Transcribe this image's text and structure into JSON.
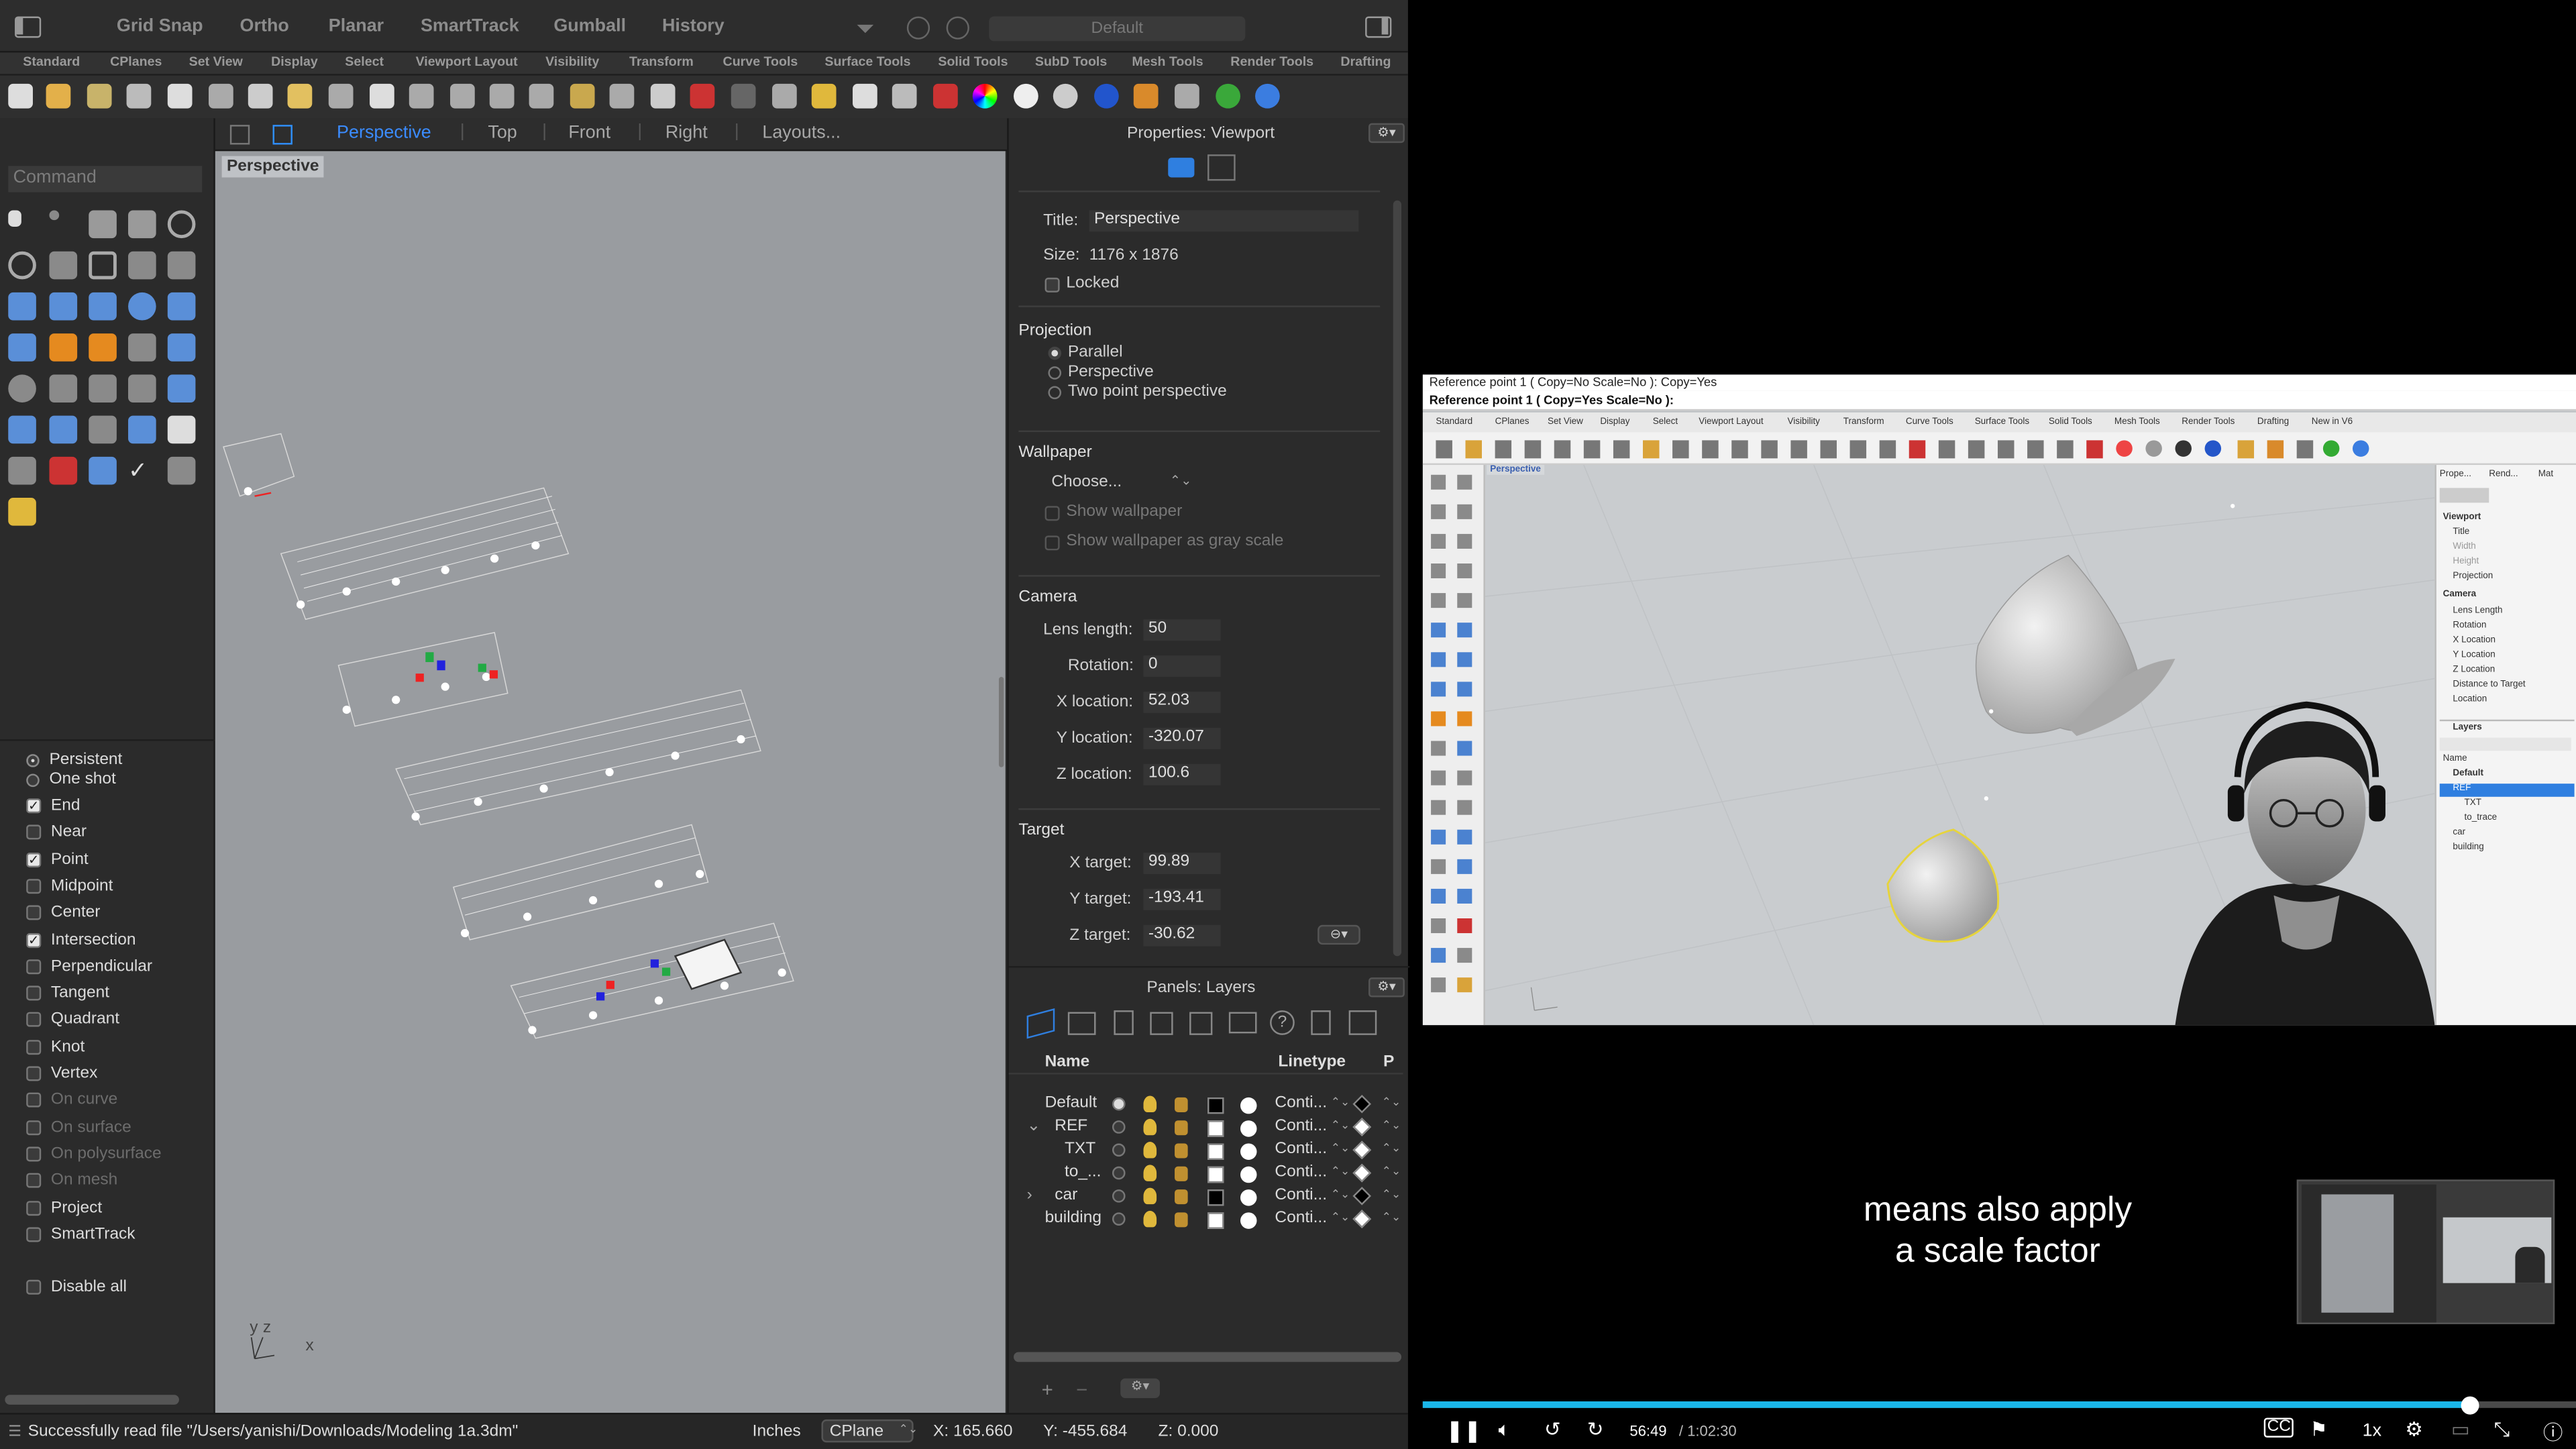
{
  "topbar": {
    "items": [
      "Grid Snap",
      "Ortho",
      "Planar",
      "SmartTrack",
      "Gumball",
      "History"
    ],
    "layer_field": "Default"
  },
  "toolbar_tabs": [
    "Standard",
    "CPlanes",
    "Set View",
    "Display",
    "Select",
    "Viewport Layout",
    "Visibility",
    "Transform",
    "Curve Tools",
    "Surface Tools",
    "Solid Tools",
    "SubD Tools",
    "Mesh Tools",
    "Render Tools",
    "Drafting"
  ],
  "command": {
    "placeholder": "Command"
  },
  "view_tabs": [
    "Perspective",
    "Top",
    "Front",
    "Right",
    "Layouts..."
  ],
  "viewport": {
    "label": "Perspective",
    "axis_y": "y",
    "axis_z": "z",
    "axis_x": "x"
  },
  "osnaps": {
    "modes": [
      {
        "label": "Persistent",
        "on": true
      },
      {
        "label": "One shot",
        "on": false
      }
    ],
    "items": [
      {
        "label": "End",
        "checked": true,
        "dim": false
      },
      {
        "label": "Near",
        "checked": false,
        "dim": false
      },
      {
        "label": "Point",
        "checked": true,
        "dim": false
      },
      {
        "label": "Midpoint",
        "checked": false,
        "dim": false
      },
      {
        "label": "Center",
        "checked": false,
        "dim": false
      },
      {
        "label": "Intersection",
        "checked": true,
        "dim": false
      },
      {
        "label": "Perpendicular",
        "checked": false,
        "dim": false
      },
      {
        "label": "Tangent",
        "checked": false,
        "dim": false
      },
      {
        "label": "Quadrant",
        "checked": false,
        "dim": false
      },
      {
        "label": "Knot",
        "checked": false,
        "dim": false
      },
      {
        "label": "Vertex",
        "checked": false,
        "dim": false
      },
      {
        "label": "On curve",
        "checked": false,
        "dim": true
      },
      {
        "label": "On surface",
        "checked": false,
        "dim": true
      },
      {
        "label": "On polysurface",
        "checked": false,
        "dim": true
      },
      {
        "label": "On mesh",
        "checked": false,
        "dim": true
      },
      {
        "label": "Project",
        "checked": false,
        "dim": false
      },
      {
        "label": "SmartTrack",
        "checked": false,
        "dim": false
      }
    ],
    "disable_all": "Disable all"
  },
  "properties": {
    "header": "Properties: Viewport",
    "title_label": "Title:",
    "title_value": "Perspective",
    "size_label": "Size:",
    "size_value": "1176 x 1876",
    "locked": "Locked",
    "projection": "Projection",
    "proj_options": [
      "Parallel",
      "Perspective",
      "Two point perspective"
    ],
    "wallpaper": "Wallpaper",
    "choose": "Choose...",
    "show_wallpaper": "Show wallpaper",
    "show_gray": "Show wallpaper as gray scale",
    "camera": "Camera",
    "lens_label": "Lens length:",
    "lens": "50",
    "rot_label": "Rotation:",
    "rot": "0",
    "xloc_label": "X location:",
    "xloc": "52.03",
    "yloc_label": "Y location:",
    "yloc": "-320.07",
    "zloc_label": "Z location:",
    "zloc": "100.6",
    "target": "Target",
    "xt_label": "X target:",
    "xt": "99.89",
    "yt_label": "Y target:",
    "yt": "-193.41",
    "zt_label": "Z target:",
    "zt": "-30.62"
  },
  "layers": {
    "header": "Panels: Layers",
    "col_name": "Name",
    "col_linetype": "Linetype",
    "col_p": "P",
    "rows": [
      {
        "name": "Default",
        "linetype": "Conti...",
        "color": "#000000"
      },
      {
        "name": "REF",
        "linetype": "Conti...",
        "color": "#ffffff"
      },
      {
        "name": "TXT",
        "linetype": "Conti...",
        "color": "#ffffff"
      },
      {
        "name": "to_...",
        "linetype": "Conti...",
        "color": "#ffffff"
      },
      {
        "name": "car",
        "linetype": "Conti...",
        "color": "#000000"
      },
      {
        "name": "building",
        "linetype": "Conti...",
        "color": "#ffffff"
      }
    ]
  },
  "status": {
    "message": "Successfully read file \"/Users/yanishi/Downloads/Modeling 1a.3dm\"",
    "units": "Inches",
    "cplane": "CPlane",
    "x": "X: 165.660",
    "y": "Y: -455.684",
    "z": "Z: 0.000"
  },
  "video": {
    "line1": "Reference point 1 ( Copy=No  Scale=No ): Copy=Yes",
    "line2": "Reference point 1 ( Copy=Yes  Scale=No ):",
    "tabs": [
      "Standard",
      "CPlanes",
      "Set View",
      "Display",
      "Select",
      "Viewport Layout",
      "Visibility",
      "Transform",
      "Curve Tools",
      "Surface Tools",
      "Solid Tools",
      "Mesh Tools",
      "Render Tools",
      "Drafting",
      "New in V6"
    ],
    "viewport_label": "Perspective",
    "side_tabs": [
      "Prope...",
      "Rend...",
      "Mat"
    ],
    "side_items": [
      "Viewport",
      "Title",
      "Width",
      "Height",
      "Projection",
      "Camera",
      "Lens Length",
      "Rotation",
      "X Location",
      "Y Location",
      "Z Location",
      "Distance to Target",
      "Location"
    ],
    "layers_title": "Layers",
    "layer_col": "Name",
    "layer_items": [
      "Default",
      "REF",
      "TXT",
      "to_trace",
      "car",
      "building"
    ],
    "caption_line1": "means also apply",
    "caption_line2": "a scale factor",
    "time_current": "56:49",
    "time_total": "/ 1:02:30",
    "speed": "1x",
    "progress": 0.907
  }
}
